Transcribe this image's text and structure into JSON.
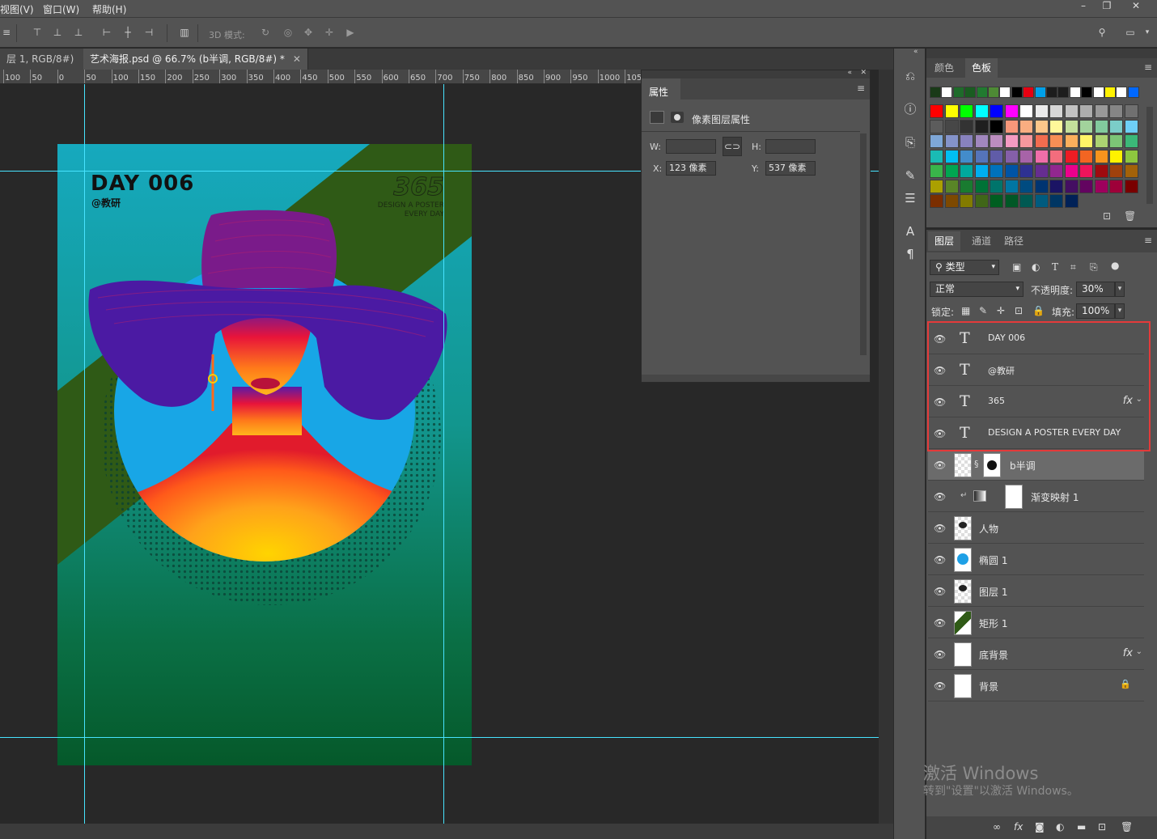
{
  "menu": {
    "items": [
      "视图(V)",
      "窗口(W)",
      "帮助(H)"
    ],
    "min": "–",
    "restore": "❐",
    "close": "✕"
  },
  "options": {
    "mode3d": "3D 模式:"
  },
  "tabs": [
    {
      "label": "层 1, RGB/8#)",
      "close": "✕"
    },
    {
      "label": "艺术海报.psd @ 66.7% (b半调, RGB/8#) *",
      "close": "✕"
    }
  ],
  "ruler": [
    "100",
    "50",
    "0",
    "50",
    "100",
    "150",
    "200",
    "250",
    "300",
    "350",
    "400",
    "450",
    "500",
    "550",
    "600",
    "650",
    "700",
    "750",
    "800",
    "850",
    "900",
    "950",
    "1000",
    "105"
  ],
  "poster": {
    "title": "DAY  006",
    "subtitle": "@教研",
    "number": "365",
    "tagline1": "DESIGN A POSTER",
    "tagline2": "EVERY DAY"
  },
  "properties": {
    "tab": "属性",
    "header": "像素图层属性",
    "w_label": "W:",
    "h_label": "H:",
    "x_label": "X:",
    "y_label": "Y:",
    "x_value": "123 像素",
    "y_value": "537 像素"
  },
  "swatch_panel": {
    "tab_color": "颜色",
    "tab_swatches": "色板"
  },
  "swatch_colors": [
    "#1a3a18",
    "#ffffff",
    "#1e6b2a",
    "#1a5c21",
    "#217a30",
    "#4e8a35",
    "#ffffff",
    "#000000",
    "#e60012",
    "#00a0e9",
    "#1d1d1d",
    "#1d1d1d",
    "#ffffff",
    "#000000",
    "#ffffff",
    "#fff100",
    "#ffffff",
    "#0068ff",
    "#ff0000",
    "#ffff00",
    "#00ff00",
    "#00ffff",
    "#0000ff",
    "#ff00ff",
    "#ffffff",
    "#ebebeb",
    "#d6d6d6",
    "#c2c2c2",
    "#adadad",
    "#999999",
    "#858585",
    "#707070",
    "#5c5c5c",
    "#474747",
    "#333333",
    "#1f1f1f",
    "#000000",
    "#f7977a",
    "#f9ad81",
    "#fdc68a",
    "#fff79a",
    "#c4df9b",
    "#a2d39c",
    "#82ca9d",
    "#7bcdc8",
    "#6ecff6",
    "#7ea7d8",
    "#8493ca",
    "#8882be",
    "#a187be",
    "#bc8dbf",
    "#f49ac2",
    "#f6989d",
    "#f26c4f",
    "#f68e55",
    "#fbaf5c",
    "#fff467",
    "#acd372",
    "#7cc576",
    "#3bb878",
    "#1abbb4",
    "#00bff3",
    "#438cca",
    "#5574b9",
    "#605ca8",
    "#855fa8",
    "#a763a8",
    "#f06ea9",
    "#f26d7d",
    "#ed1c24",
    "#f26522",
    "#f7941d",
    "#fff200",
    "#8dc73f",
    "#39b54a",
    "#00a651",
    "#00a99d",
    "#00aeef",
    "#0072bc",
    "#0054a6",
    "#2e3192",
    "#662d91",
    "#92278f",
    "#ec008c",
    "#ed145b",
    "#9e0b0f",
    "#a0410d",
    "#a36209",
    "#aba000",
    "#598527",
    "#197b30",
    "#007236",
    "#00746b",
    "#0076a3",
    "#004b80",
    "#003471",
    "#1b1464",
    "#440e62",
    "#630460",
    "#9e005d",
    "#9e0039",
    "#790000",
    "#7b2e00",
    "#7d4900",
    "#827b00",
    "#406618",
    "#005e20",
    "#005826",
    "#005952",
    "#005b7f",
    "#003663",
    "#002157"
  ],
  "layers_panel": {
    "tab_layers": "图层",
    "tab_channels": "通道",
    "tab_paths": "路径",
    "filter": "类型",
    "blend_mode": "正常",
    "opacity_label": "不透明度:",
    "opacity": "30%",
    "lock_label": "锁定:",
    "fill_label": "填充:",
    "fill": "100%",
    "layers": [
      {
        "name": "DAY  006",
        "kind": "text"
      },
      {
        "name": "@教研",
        "kind": "text"
      },
      {
        "name": "365",
        "kind": "text",
        "fx": "fx"
      },
      {
        "name": "DESIGN A POSTER EVERY DAY",
        "kind": "text"
      },
      {
        "name": "b半调",
        "kind": "pixel-mask"
      },
      {
        "name": "渐变映射 1",
        "kind": "adjustment"
      },
      {
        "name": "人物",
        "kind": "pixel"
      },
      {
        "name": "椭圆 1",
        "kind": "shape"
      },
      {
        "name": "图层 1",
        "kind": "pixel"
      },
      {
        "name": "矩形 1",
        "kind": "shape"
      },
      {
        "name": "底背景",
        "kind": "pixel",
        "fx": "fx"
      },
      {
        "name": "背景",
        "kind": "pixel"
      }
    ]
  },
  "watermark": {
    "line1": "激活 Windows",
    "line2": "转到\"设置\"以激活 Windows。"
  }
}
